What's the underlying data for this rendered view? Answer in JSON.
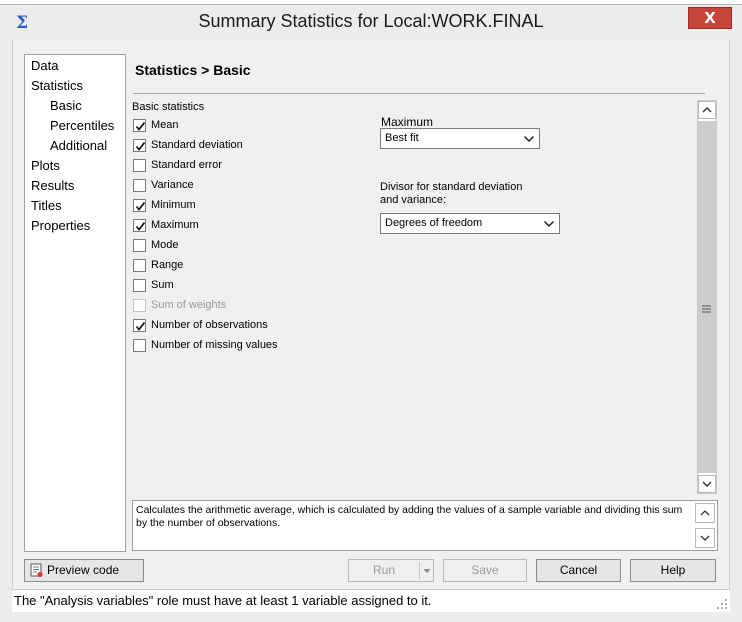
{
  "window": {
    "title": "Summary Statistics for Local:WORK.FINAL",
    "app_icon_glyph": "Σ",
    "close_glyph": "X"
  },
  "nav": {
    "items": [
      {
        "label": "Data",
        "level": 0
      },
      {
        "label": "Statistics",
        "level": 0
      },
      {
        "label": "Basic",
        "level": 1,
        "selected": true
      },
      {
        "label": "Percentiles",
        "level": 1
      },
      {
        "label": "Additional",
        "level": 1
      },
      {
        "label": "Plots",
        "level": 0
      },
      {
        "label": "Results",
        "level": 0
      },
      {
        "label": "Titles",
        "level": 0
      },
      {
        "label": "Properties",
        "level": 0
      }
    ]
  },
  "page": {
    "heading": "Statistics > Basic",
    "group_label": "Basic statistics"
  },
  "checkboxes": [
    {
      "label": "Mean",
      "checked": true,
      "enabled": true
    },
    {
      "label": "Standard deviation",
      "checked": true,
      "enabled": true
    },
    {
      "label": "Standard error",
      "checked": false,
      "enabled": true
    },
    {
      "label": "Variance",
      "checked": false,
      "enabled": true
    },
    {
      "label": "Minimum",
      "checked": true,
      "enabled": true
    },
    {
      "label": "Maximum",
      "checked": true,
      "enabled": true
    },
    {
      "label": "Mode",
      "checked": false,
      "enabled": true
    },
    {
      "label": "Range",
      "checked": false,
      "enabled": true
    },
    {
      "label": "Sum",
      "checked": false,
      "enabled": true
    },
    {
      "label": "Sum of weights",
      "checked": false,
      "enabled": false
    },
    {
      "label": "Number of observations",
      "checked": true,
      "enabled": true
    },
    {
      "label": "Number of missing values",
      "checked": false,
      "enabled": true
    }
  ],
  "maximum": {
    "label": "Maximum",
    "value": "Best fit"
  },
  "divisor": {
    "label_line1": "Divisor for standard deviation",
    "label_line2": "and variance:",
    "value": "Degrees of freedom"
  },
  "description": "Calculates the arithmetic average, which is calculated by adding the values of a sample variable and dividing this sum by the number of observations.",
  "buttons": {
    "preview_code": "Preview code",
    "run": "Run",
    "save": "Save",
    "cancel": "Cancel",
    "help": "Help"
  },
  "status": "The \"Analysis variables\" role must have at least 1 variable assigned to it.",
  "colors": {
    "close_button": "#c7443a",
    "app_icon": "#2b62c0",
    "disabled_text": "#9a9a9a"
  }
}
